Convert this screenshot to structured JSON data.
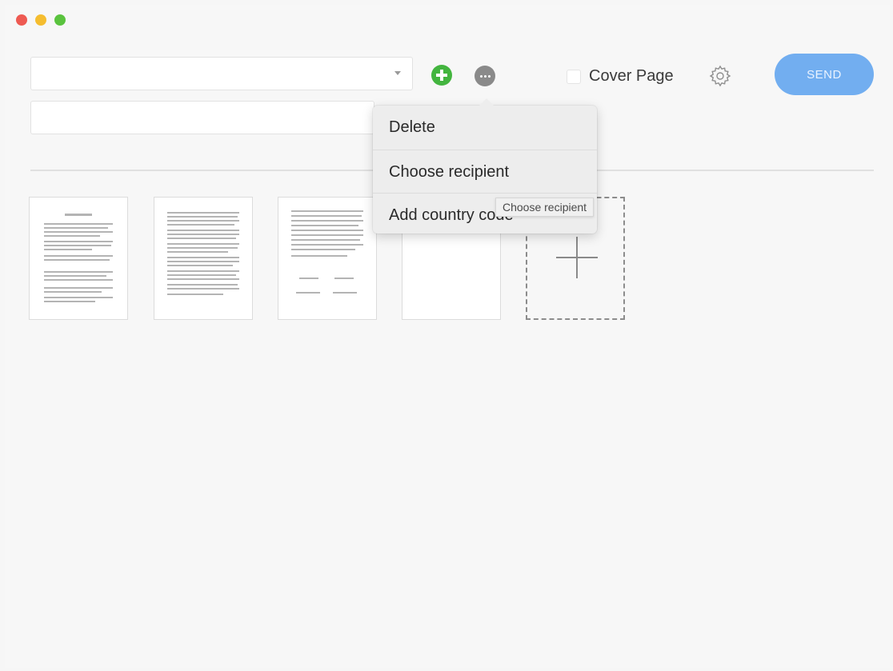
{
  "window": {
    "controls": [
      "close",
      "minimize",
      "maximize"
    ]
  },
  "toolbar": {
    "recipient_value": "",
    "subject_value": "",
    "add_recipient_icon": "plus-circle-icon",
    "more_options_icon": "ellipsis-circle-icon",
    "cover_page_label": "Cover Page",
    "cover_page_checked": false,
    "settings_icon": "gear-icon",
    "send_label": "SEND"
  },
  "colors": {
    "add_button": "#43b53f",
    "send_button": "#72aef0",
    "close": "#ee5a52",
    "minimize": "#f5bd2f",
    "maximize": "#5ac33e"
  },
  "pages": {
    "thumbnails": [
      {
        "kind": "document"
      },
      {
        "kind": "document"
      },
      {
        "kind": "document"
      },
      {
        "kind": "blank"
      }
    ],
    "add_page_icon": "plus-icon"
  },
  "context_menu": {
    "items": [
      {
        "label": "Delete"
      },
      {
        "label": "Choose recipient"
      },
      {
        "label": "Add country code"
      }
    ]
  },
  "tooltip": {
    "text": "Choose recipient"
  }
}
